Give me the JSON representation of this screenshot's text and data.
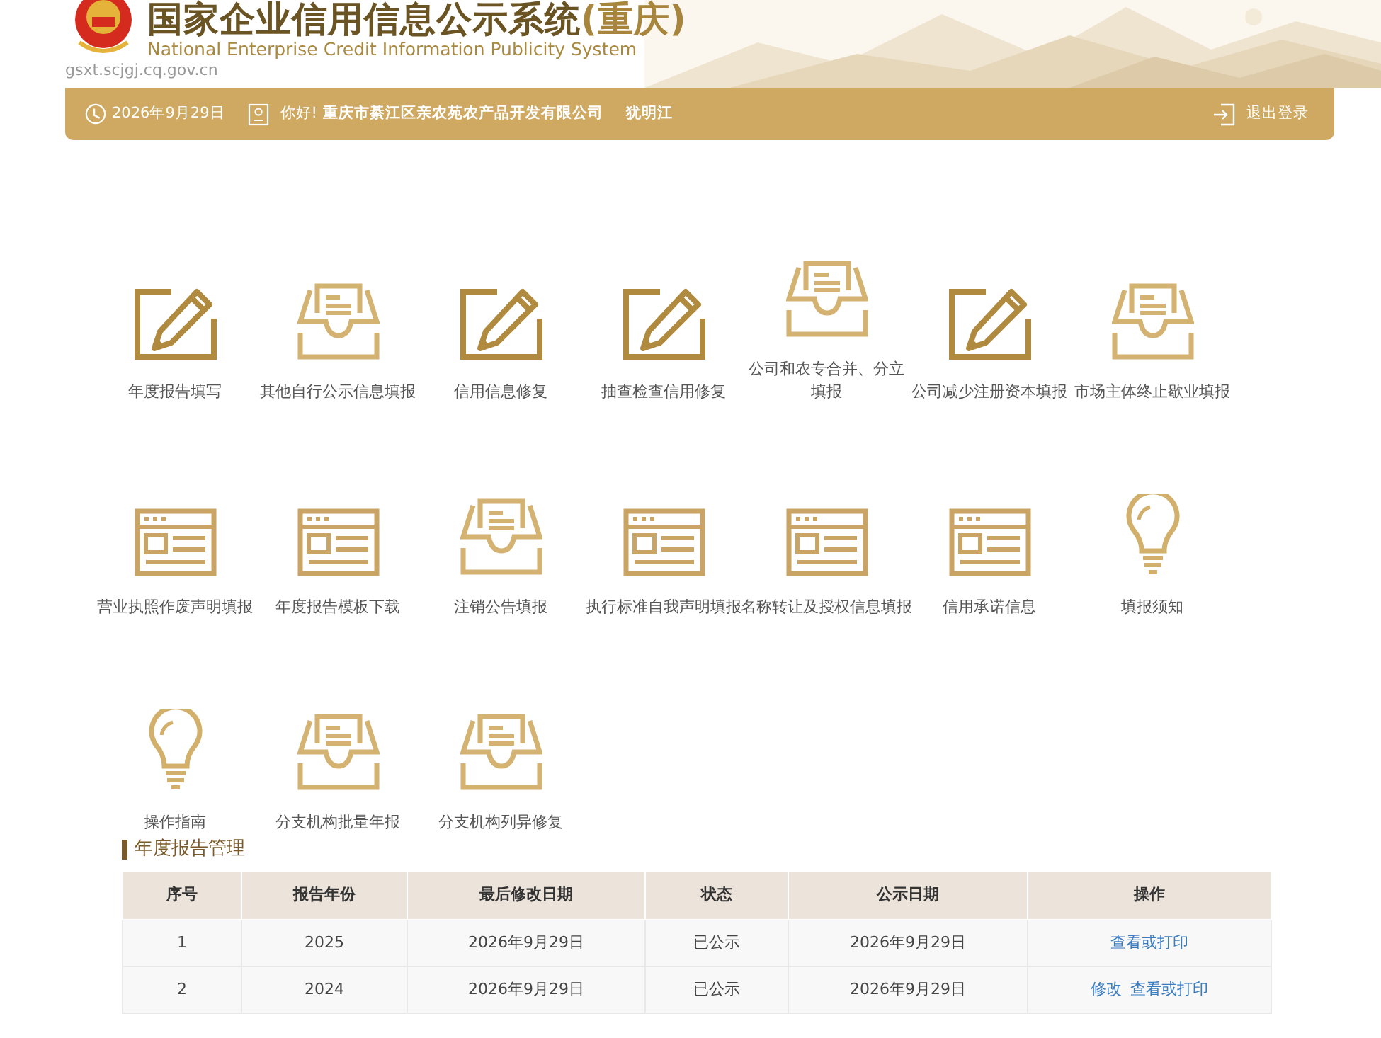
{
  "header": {
    "title": "国家企业信用信息公示系统",
    "region": "(重庆)",
    "subtitle": "National Enterprise Credit Information Publicity System",
    "url": "gsxt.scjgj.cq.gov.cn"
  },
  "top_bar": {
    "date": "2026年9月29日",
    "greeting": "你好!",
    "company": "重庆市綦江区亲农苑农产品开发有限公司",
    "user": "犹明江",
    "logout": "退出登录"
  },
  "menu": [
    {
      "label": "年度报告填写",
      "kind": "edit"
    },
    {
      "label": "其他自行公示信息填报",
      "kind": "inbox"
    },
    {
      "label": "信用信息修复",
      "kind": "edit"
    },
    {
      "label": "抽查检查信用修复",
      "kind": "edit"
    },
    {
      "label": "公司和农专合并、分立填报",
      "kind": "inbox"
    },
    {
      "label": "公司减少注册资本填报",
      "kind": "edit"
    },
    {
      "label": "市场主体终止歇业填报",
      "kind": "inbox"
    },
    {
      "label": "营业执照作废声明填报",
      "kind": "form"
    },
    {
      "label": "年度报告模板下载",
      "kind": "form"
    },
    {
      "label": "注销公告填报",
      "kind": "inbox"
    },
    {
      "label": "执行标准自我声明填报",
      "kind": "form"
    },
    {
      "label": "名称转让及授权信息填报",
      "kind": "form"
    },
    {
      "label": "信用承诺信息",
      "kind": "form"
    },
    {
      "label": "填报须知",
      "kind": "bulb"
    },
    {
      "label": "操作指南",
      "kind": "bulb"
    },
    {
      "label": "分支机构批量年报",
      "kind": "inbox"
    },
    {
      "label": "分支机构列异修复",
      "kind": "inbox"
    }
  ],
  "section_title": "年度报告管理",
  "table": {
    "columns": [
      "序号",
      "报告年份",
      "最后修改日期",
      "状态",
      "公示日期",
      "操作"
    ],
    "rows": [
      {
        "cells": [
          "1",
          "2025",
          "2026年9月29日",
          "已公示",
          "2026年9月29日"
        ],
        "actions": [
          "查看或打印"
        ]
      },
      {
        "cells": [
          "2",
          "2024",
          "2026年9月29日",
          "已公示",
          "2026年9月29日"
        ],
        "actions": [
          "修改",
          "查看或打印"
        ]
      }
    ]
  }
}
